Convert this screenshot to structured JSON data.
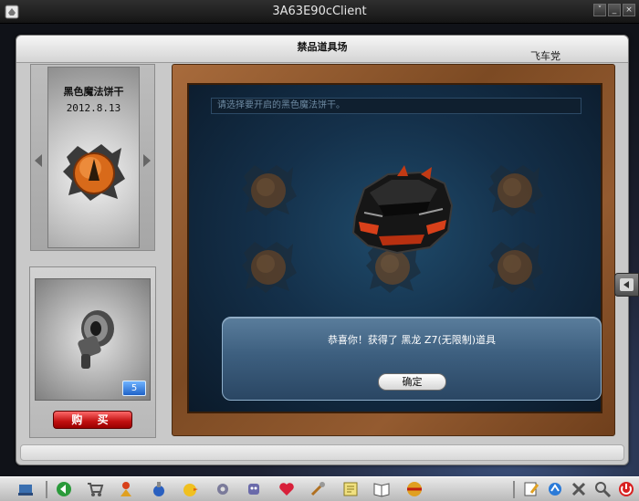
{
  "window": {
    "title": "3A63E90cClient",
    "controls": [
      "˅",
      "_",
      "×"
    ]
  },
  "shop": {
    "title": "禁品道具场",
    "subtitle": "飞车党"
  },
  "item": {
    "name": "黑色魔法饼干",
    "date": "2012.8.13"
  },
  "preview": {
    "quantity": "5",
    "buy_label": "购 买"
  },
  "board": {
    "placeholder": "请选择要开启的黑色魔法饼干。"
  },
  "dialog": {
    "message": "恭喜你！获得了 黑龙 Z7(无限制)道具",
    "ok_label": "确定"
  },
  "colors": {
    "accent_red": "#c01010",
    "dialog_blue": "#3d5f7f",
    "wood": "#7c4a23",
    "board": "#14304a"
  },
  "taskbar": {
    "icons": [
      "desktop-icon",
      "back-icon",
      "cart-icon",
      "character-icon",
      "drink-icon",
      "duck-icon",
      "gear-icon",
      "robot-icon",
      "heart-icon",
      "tool-icon",
      "note-icon",
      "book-icon",
      "capsule-icon",
      "pencil-icon",
      "phoenix-icon",
      "settings-icon",
      "search-icon",
      "power-icon"
    ]
  }
}
